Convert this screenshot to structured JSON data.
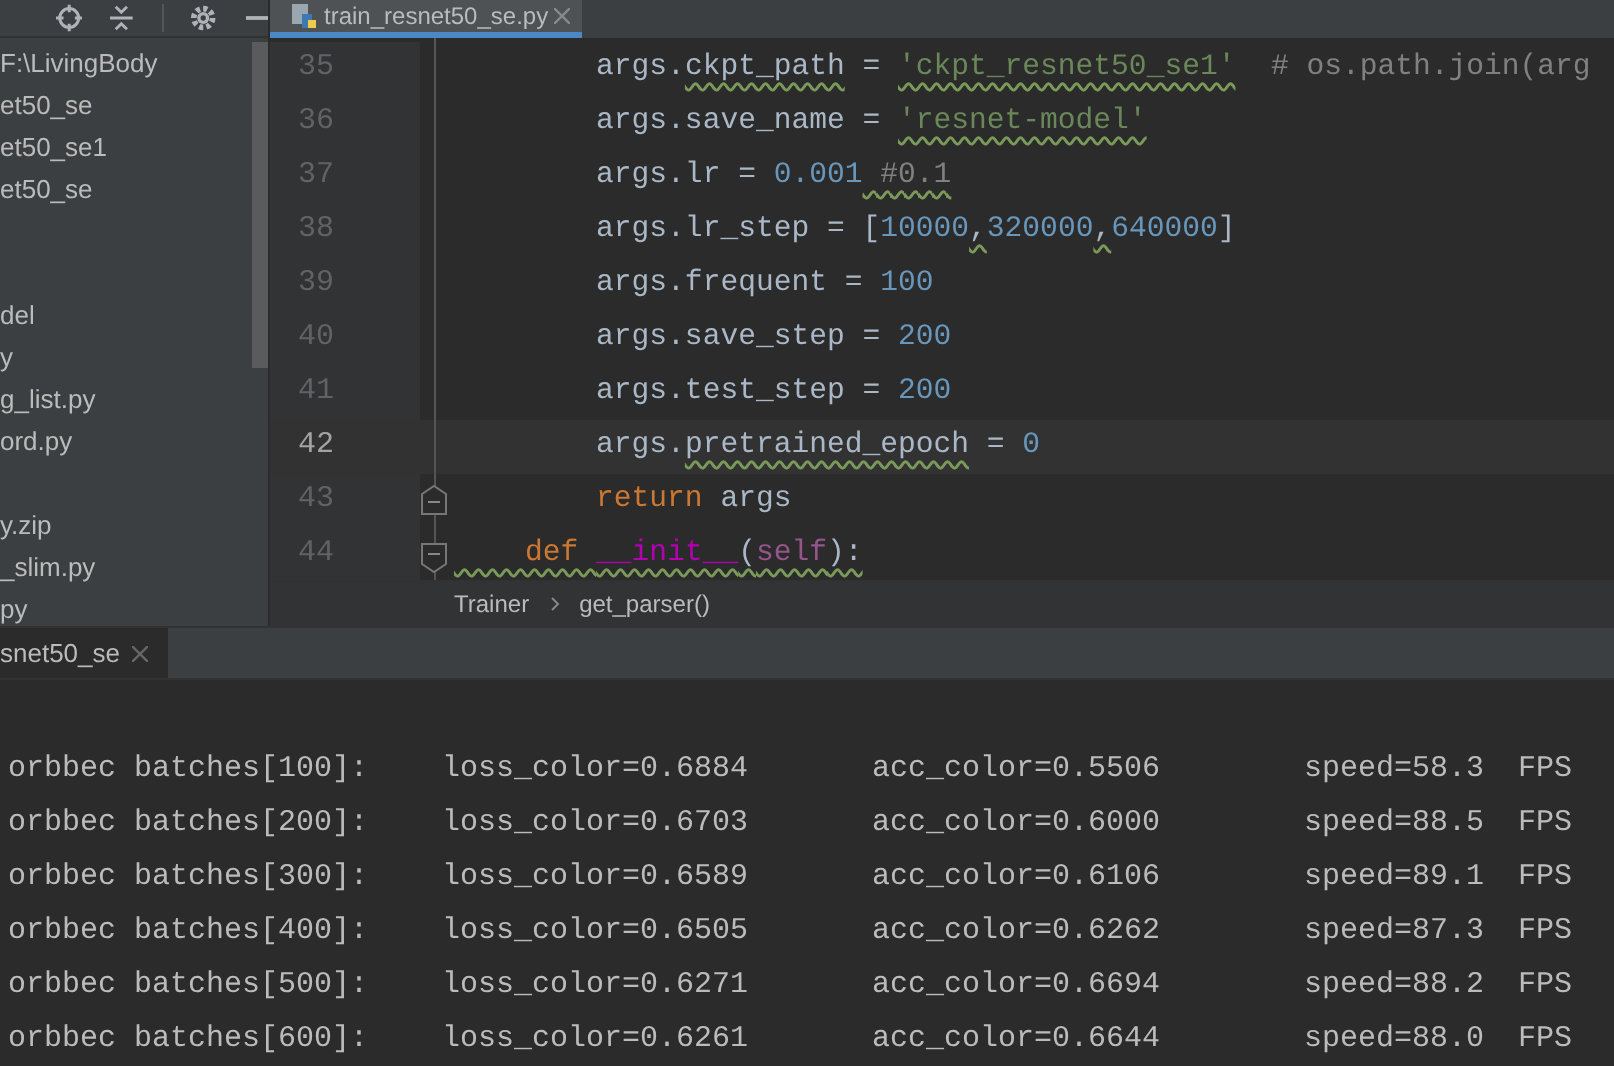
{
  "project_panel": {
    "tree": [
      {
        "kind": "row",
        "label": "F:\\LivingBody"
      },
      {
        "kind": "row",
        "label": "et50_se"
      },
      {
        "kind": "row",
        "label": "et50_se1"
      },
      {
        "kind": "row",
        "label": "et50_se"
      },
      {
        "kind": "after_blanks",
        "label": "del"
      },
      {
        "kind": "row",
        "label": "y"
      },
      {
        "kind": "row",
        "label": "g_list.py"
      },
      {
        "kind": "row",
        "label": "ord.py"
      },
      {
        "kind": "after_blank",
        "label": "y.zip"
      },
      {
        "kind": "row",
        "label": "_slim.py"
      },
      {
        "kind": "row",
        "label": "py"
      }
    ]
  },
  "editor": {
    "tabs": [
      {
        "label": "train_resnet50_se.py",
        "selected": true
      }
    ],
    "lines": [
      {
        "number": "35",
        "current": false,
        "tokens": [
          {
            "kind": "plain",
            "text": "        args.",
            "underlined": false
          },
          {
            "kind": "plain",
            "text": "ckpt_path",
            "underlined": true
          },
          {
            "kind": "plain",
            "text": " = ",
            "underlined": false
          },
          {
            "kind": "string",
            "text": "'ckpt_resnet50_se1'",
            "underlined": true
          },
          {
            "kind": "comment",
            "text": "  # os.path.join(arg",
            "underlined": false
          }
        ]
      },
      {
        "number": "36",
        "current": false,
        "tokens": [
          {
            "kind": "plain",
            "text": "        args.save_name = ",
            "underlined": false
          },
          {
            "kind": "string",
            "text": "'resnet-model'",
            "underlined": true
          }
        ]
      },
      {
        "number": "37",
        "current": false,
        "tokens": [
          {
            "kind": "plain",
            "text": "        args.lr = ",
            "underlined": false
          },
          {
            "kind": "number",
            "text": "0.001",
            "underlined": false
          },
          {
            "kind": "comment",
            "text": " #0.1",
            "underlined": true
          }
        ]
      },
      {
        "number": "38",
        "current": false,
        "tokens": [
          {
            "kind": "plain",
            "text": "        args.lr_step = [",
            "underlined": false
          },
          {
            "kind": "number",
            "text": "10000",
            "underlined": false
          },
          {
            "kind": "plain",
            "text": ",",
            "underlined": true
          },
          {
            "kind": "number",
            "text": "320000",
            "underlined": false
          },
          {
            "kind": "plain",
            "text": ",",
            "underlined": true
          },
          {
            "kind": "number",
            "text": "640000",
            "underlined": false
          },
          {
            "kind": "plain",
            "text": "]",
            "underlined": false
          }
        ]
      },
      {
        "number": "39",
        "current": false,
        "tokens": [
          {
            "kind": "plain",
            "text": "        args.frequent = ",
            "underlined": false
          },
          {
            "kind": "number",
            "text": "100",
            "underlined": false
          }
        ]
      },
      {
        "number": "40",
        "current": false,
        "tokens": [
          {
            "kind": "plain",
            "text": "        args.save_step = ",
            "underlined": false
          },
          {
            "kind": "number",
            "text": "200",
            "underlined": false
          }
        ]
      },
      {
        "number": "41",
        "current": false,
        "tokens": [
          {
            "kind": "plain",
            "text": "        args.test_step = ",
            "underlined": false
          },
          {
            "kind": "number",
            "text": "200",
            "underlined": false
          }
        ]
      },
      {
        "number": "42",
        "current": true,
        "tokens": [
          {
            "kind": "plain",
            "text": "        args.",
            "underlined": false
          },
          {
            "kind": "plain",
            "text": "pretrained_epoch",
            "underlined": true
          },
          {
            "kind": "plain",
            "text": " = ",
            "underlined": false
          },
          {
            "kind": "number",
            "text": "0",
            "underlined": false
          }
        ]
      },
      {
        "number": "43",
        "current": false,
        "tokens": [
          {
            "kind": "keyword",
            "text": "        return",
            "underlined": false
          },
          {
            "kind": "plain",
            "text": " args",
            "underlined": false
          }
        ]
      },
      {
        "number": "44",
        "current": false,
        "tokens": [
          {
            "kind": "keyword",
            "text": "    def ",
            "underlined": true
          },
          {
            "kind": "magic",
            "text": "__init__",
            "underlined": true
          },
          {
            "kind": "plain",
            "text": "(",
            "underlined": true
          },
          {
            "kind": "self",
            "text": "self",
            "underlined": true
          },
          {
            "kind": "plain",
            "text": "):",
            "underlined": true
          }
        ]
      }
    ],
    "breadcrumbs": [
      "Trainer",
      "get_parser()"
    ]
  },
  "run_panel": {
    "tabs": [
      {
        "label": "snet50_se",
        "selected": true
      }
    ],
    "output": [
      {
        "batch": "orbbec batches[100]:",
        "loss": "loss_color=0.6884",
        "acc": "acc_color=0.5506",
        "speed": "speed=58.3",
        "unit": "FPS"
      },
      {
        "batch": "orbbec batches[200]:",
        "loss": "loss_color=0.6703",
        "acc": "acc_color=0.6000",
        "speed": "speed=88.5",
        "unit": "FPS"
      },
      {
        "batch": "orbbec batches[300]:",
        "loss": "loss_color=0.6589",
        "acc": "acc_color=0.6106",
        "speed": "speed=89.1",
        "unit": "FPS"
      },
      {
        "batch": "orbbec batches[400]:",
        "loss": "loss_color=0.6505",
        "acc": "acc_color=0.6262",
        "speed": "speed=87.3",
        "unit": "FPS"
      },
      {
        "batch": "orbbec batches[500]:",
        "loss": "loss_color=0.6271",
        "acc": "acc_color=0.6694",
        "speed": "speed=88.2",
        "unit": "FPS"
      },
      {
        "batch": "orbbec batches[600]:",
        "loss": "loss_color=0.6261",
        "acc": "acc_color=0.6644",
        "speed": "speed=88.0",
        "unit": "FPS"
      }
    ]
  }
}
